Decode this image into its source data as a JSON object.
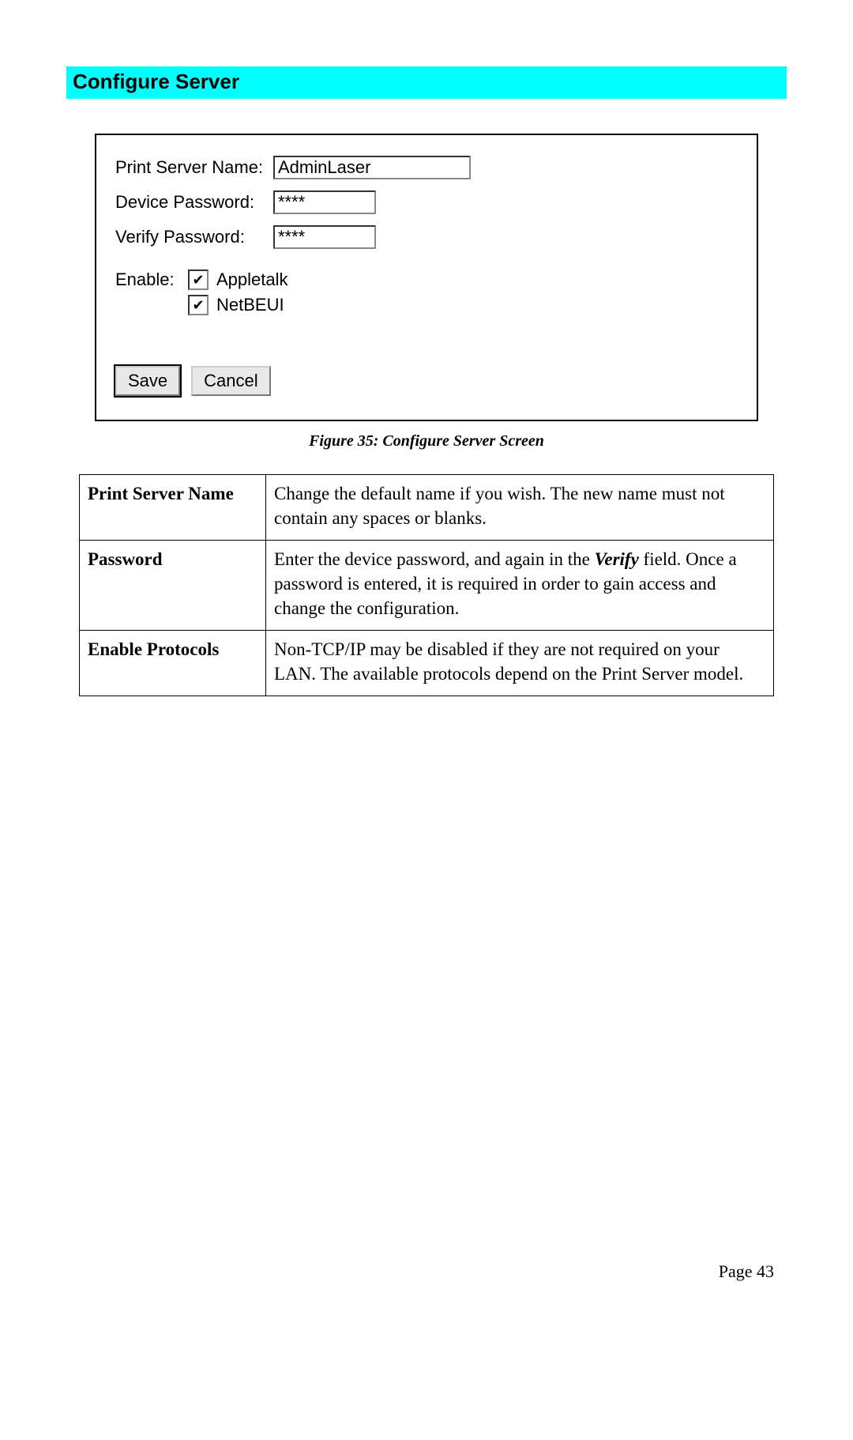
{
  "header": {
    "title": "Configure Server"
  },
  "form": {
    "server_label": "Print Server Name:",
    "server_value": "AdminLaser",
    "device_pw_label": "Device Password:",
    "device_pw_value": "****",
    "verify_pw_label": "Verify Password:",
    "verify_pw_value": "****",
    "enable_label": "Enable:",
    "checkbox1_label": "Appletalk",
    "checkbox2_label": "NetBEUI",
    "save_label": "Save",
    "cancel_label": "Cancel",
    "check_mark": "✔"
  },
  "caption": "Figure 35: Configure Server Screen",
  "table": {
    "rows": [
      {
        "key": "Print Server Name",
        "desc_plain": "Change the default name if you wish. The new name must not contain any spaces or blanks."
      },
      {
        "key": "Password",
        "desc_pre": "Enter the device password, and again in the ",
        "desc_em": "Verify",
        "desc_post": " field. Once a password is entered, it is required in order to gain access and change the configuration."
      },
      {
        "key": "Enable Protocols",
        "desc_plain": "Non-TCP/IP may be disabled if they are not required on your LAN. The available protocols depend on the Print Server model."
      }
    ]
  },
  "footer": {
    "page_label": "Page 43"
  }
}
